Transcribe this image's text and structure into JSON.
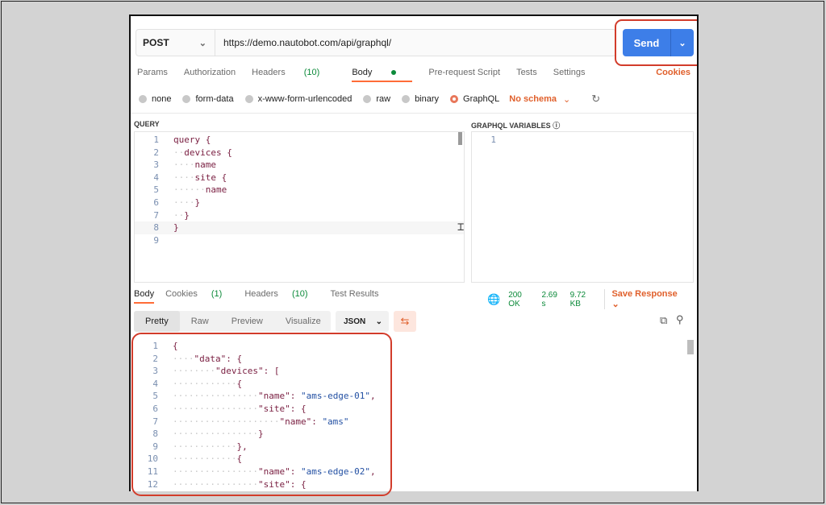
{
  "request": {
    "method": "POST",
    "url": "https://demo.nautobot.com/api/graphql/",
    "send_label": "Send"
  },
  "tabs": [
    {
      "label": "Params"
    },
    {
      "label": "Authorization"
    },
    {
      "label": "Headers",
      "count": "(10)"
    },
    {
      "label": "Body"
    },
    {
      "label": "Pre-request Script"
    },
    {
      "label": "Tests"
    },
    {
      "label": "Settings"
    }
  ],
  "cookies_link": "Cookies",
  "body_modes": [
    "none",
    "form-data",
    "x-www-form-urlencoded",
    "raw",
    "binary",
    "GraphQL"
  ],
  "schema_label": "No schema",
  "query_title": "QUERY",
  "variables_title": "GRAPHQL VARIABLES",
  "query_lines": [
    {
      "n": "1",
      "text": "query {"
    },
    {
      "n": "2",
      "text": "  devices {"
    },
    {
      "n": "3",
      "text": "    name"
    },
    {
      "n": "4",
      "text": "    site {"
    },
    {
      "n": "5",
      "text": "      name"
    },
    {
      "n": "6",
      "text": "    }"
    },
    {
      "n": "7",
      "text": "  }"
    },
    {
      "n": "8",
      "text": "}"
    },
    {
      "n": "9",
      "text": ""
    }
  ],
  "variables_lines": [
    {
      "n": "1",
      "text": ""
    }
  ],
  "response_tabs": [
    {
      "label": "Body"
    },
    {
      "label": "Cookies",
      "count": "(1)"
    },
    {
      "label": "Headers",
      "count": "(10)"
    },
    {
      "label": "Test Results"
    }
  ],
  "response_status": {
    "status": "200 OK",
    "time": "2.69 s",
    "size": "9.72 KB",
    "save_label": "Save Response"
  },
  "view_modes": [
    "Pretty",
    "Raw",
    "Preview",
    "Visualize"
  ],
  "format": "JSON",
  "response_lines": [
    {
      "n": "1",
      "text": "{"
    },
    {
      "n": "2",
      "text": "    \"data\": {"
    },
    {
      "n": "3",
      "text": "        \"devices\": ["
    },
    {
      "n": "4",
      "text": "            {"
    },
    {
      "n": "5",
      "text": "                \"name\": \"ams-edge-01\","
    },
    {
      "n": "6",
      "text": "                \"site\": {"
    },
    {
      "n": "7",
      "text": "                    \"name\": \"ams\""
    },
    {
      "n": "8",
      "text": "                }"
    },
    {
      "n": "9",
      "text": "            },"
    },
    {
      "n": "10",
      "text": "            {"
    },
    {
      "n": "11",
      "text": "                \"name\": \"ams-edge-02\","
    },
    {
      "n": "12",
      "text": "                \"site\": {"
    }
  ],
  "colors": {
    "accent": "#ff6c37",
    "send": "#3d7ee8",
    "ok": "#0c8a3a",
    "highlight": "#d23c2b"
  }
}
